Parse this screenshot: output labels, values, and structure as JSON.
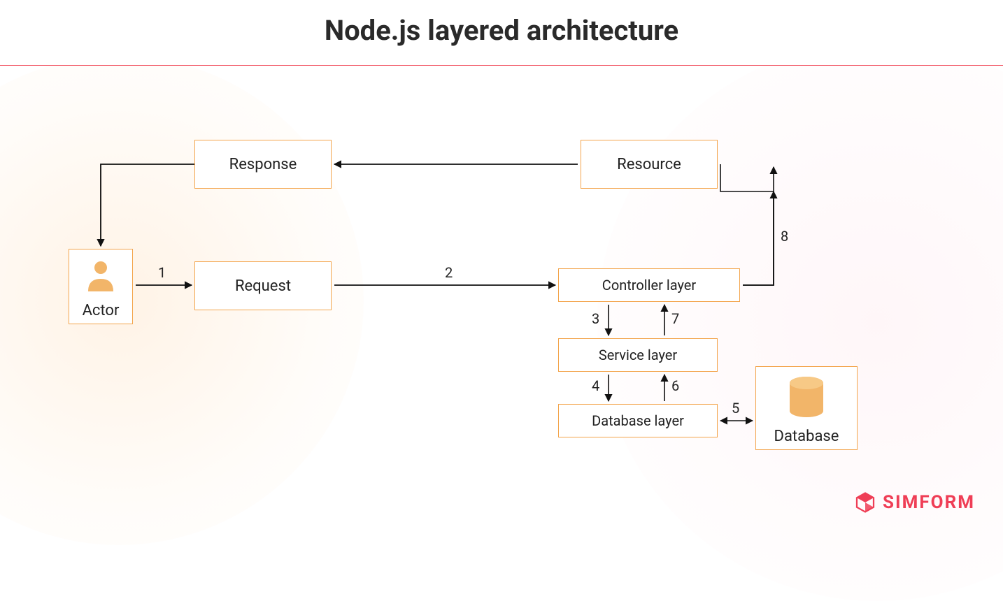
{
  "title": "Node.js layered architecture",
  "nodes": {
    "actor": "Actor",
    "response": "Response",
    "request": "Request",
    "resource": "Resource",
    "controller": "Controller layer",
    "service": "Service layer",
    "databaseLayer": "Database layer",
    "database": "Database"
  },
  "edges": {
    "e1": "1",
    "e2": "2",
    "e3": "3",
    "e4": "4",
    "e5": "5",
    "e6": "6",
    "e7": "7",
    "e8": "8"
  },
  "brand": "SIMFORM",
  "colors": {
    "border": "#f3a44b",
    "accent": "#ef3e56",
    "iconFill": "#f2b569"
  }
}
